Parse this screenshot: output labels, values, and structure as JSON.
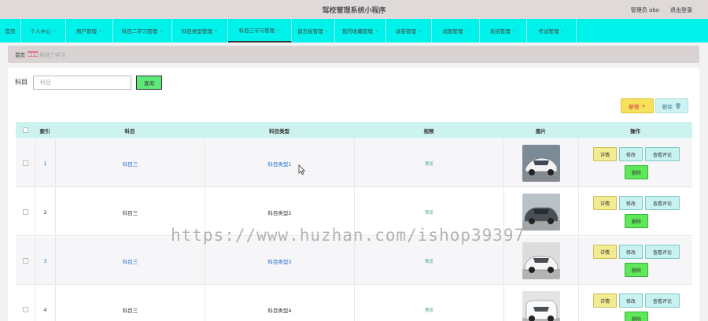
{
  "app_title": "驾校管理系统小程序",
  "user": {
    "role_name": "管理员 abo",
    "logout": "退出登录"
  },
  "nav": [
    {
      "label": "首页",
      "chevron": false
    },
    {
      "label": "个人中心",
      "chevron": true
    },
    {
      "label": "用户管理",
      "chevron": true
    },
    {
      "label": "科目二学习管理",
      "chevron": true
    },
    {
      "label": "科目类型管理",
      "chevron": true
    },
    {
      "label": "科目三学习管理",
      "chevron": true,
      "active": true
    },
    {
      "label": "留言板管理",
      "chevron": true
    },
    {
      "label": "我的收藏管理",
      "chevron": true
    },
    {
      "label": "试卷管理",
      "chevron": true
    },
    {
      "label": "试题管理",
      "chevron": true
    },
    {
      "label": "系统管理",
      "chevron": true
    },
    {
      "label": "考试管理",
      "chevron": true
    }
  ],
  "breadcrumb": {
    "home": "首页",
    "separator": "🀆🀆🀆",
    "current": "科目三学习"
  },
  "search": {
    "label": "科目",
    "placeholder": "科目",
    "button": "查询"
  },
  "actions": {
    "add": "新增",
    "add_glyph": "+",
    "delete": "删除",
    "delete_glyph": "🗑"
  },
  "table": {
    "headers": {
      "index": "索引",
      "subject": "科目",
      "subject_type": "科目类型",
      "video": "视频",
      "image": "图片",
      "ops": "操作"
    },
    "rows": [
      {
        "index": "1",
        "subject": "科目三",
        "subject_type": "科目类型1",
        "video": "预览",
        "link": true,
        "car": "white-sports"
      },
      {
        "index": "2",
        "subject": "科目三",
        "subject_type": "科目类型2",
        "video": "预览",
        "link": false,
        "car": "gray-sedan"
      },
      {
        "index": "3",
        "subject": "科目三",
        "subject_type": "科目类型3",
        "video": "预览",
        "link": true,
        "car": "white-sedan"
      },
      {
        "index": "4",
        "subject": "科目三",
        "subject_type": "科目类型4",
        "video": "预览",
        "link": false,
        "car": "white-van"
      }
    ],
    "row_ops": {
      "detail": "详情",
      "edit": "修改",
      "review": "查看评论",
      "remove": "删除"
    }
  },
  "watermark": "https://www.huzhan.com/ishop39397",
  "colors": {
    "nav_bg": "#00f2ea",
    "topbar_bg": "#e0d9d9",
    "header_bg": "#cdf3ef",
    "link": "#2a6fd0"
  }
}
